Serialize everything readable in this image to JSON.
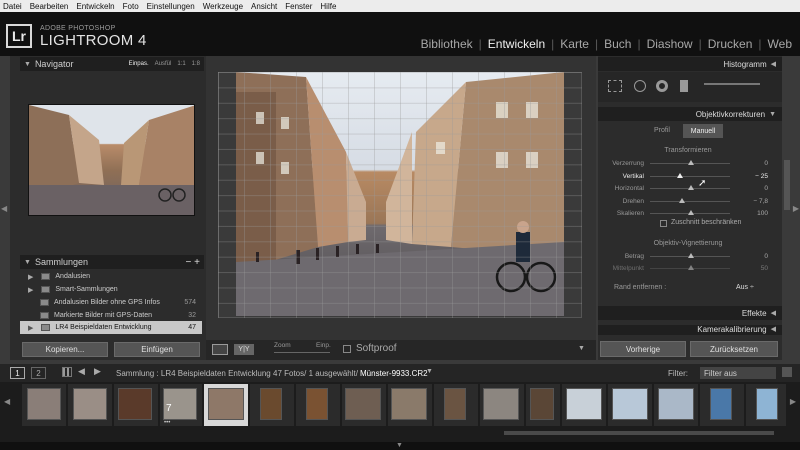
{
  "menubar": [
    "Datei",
    "Bearbeiten",
    "Entwickeln",
    "Foto",
    "Einstellungen",
    "Werkzeuge",
    "Ansicht",
    "Fenster",
    "Hilfe"
  ],
  "brand": {
    "logo": "Lr",
    "line1": "ADOBE PHOTOSHOP",
    "line2": "LIGHTROOM 4"
  },
  "modules": [
    {
      "label": "Bibliothek",
      "active": false
    },
    {
      "label": "Entwickeln",
      "active": true
    },
    {
      "label": "Karte",
      "active": false
    },
    {
      "label": "Buch",
      "active": false
    },
    {
      "label": "Diashow",
      "active": false
    },
    {
      "label": "Drucken",
      "active": false
    },
    {
      "label": "Web",
      "active": false
    }
  ],
  "navigator": {
    "title": "Navigator",
    "options": [
      "Einpas.",
      "Ausfül",
      "1:1",
      "1:8"
    ],
    "selected": "Einpas."
  },
  "collections": {
    "title": "Sammlungen",
    "items": [
      {
        "label": "Andalusien",
        "count": "",
        "selected": false
      },
      {
        "label": "Smart-Sammlungen",
        "count": "",
        "selected": false
      },
      {
        "label": "Andalusien Bilder ohne GPS Infos",
        "count": "574",
        "selected": false
      },
      {
        "label": "Markierte Bilder mit GPS-Daten",
        "count": "32",
        "selected": false
      },
      {
        "label": "LR4 Beispieldaten Entwicklung",
        "count": "47",
        "selected": true
      }
    ]
  },
  "left_buttons": {
    "copy": "Kopieren...",
    "paste": "Einfügen"
  },
  "toolbar": {
    "zoom_label": "Zoom",
    "fit_label": "Einp.",
    "softproof": "Softproof"
  },
  "right": {
    "histogram": "Histogramm",
    "lens": "Objektivkorrekturen",
    "tabs": [
      "Profil",
      "Manuell"
    ],
    "active_tab": "Manuell",
    "transform_title": "Transformieren",
    "sliders": [
      {
        "label": "Verzerrung",
        "value": "0",
        "pos": 0.5,
        "hl": false
      },
      {
        "label": "Vertikal",
        "value": "− 25",
        "pos": 0.37,
        "hl": true
      },
      {
        "label": "Horizontal",
        "value": "0",
        "pos": 0.5,
        "hl": false
      },
      {
        "label": "Drehen",
        "value": "− 7,8",
        "pos": 0.39,
        "hl": false
      },
      {
        "label": "Skalieren",
        "value": "100",
        "pos": 0.5,
        "hl": false
      }
    ],
    "crop_label": "Zuschnitt beschränken",
    "vignette_title": "Objektiv-Vignettierung",
    "vignette_sliders": [
      {
        "label": "Betrag",
        "value": "0",
        "pos": 0.5
      },
      {
        "label": "Mittelpunkt",
        "value": "50",
        "pos": 0.5
      }
    ],
    "remove_label": "Rand entfernen :",
    "remove_value": "Aus",
    "effects": "Effekte",
    "calibration": "Kamerakalibrierung",
    "prev_btn": "Vorherige",
    "reset_btn": "Zurücksetzen"
  },
  "filmstrip": {
    "page1": "1",
    "page2": "2",
    "path": "Sammlung : LR4 Beispieldaten Entwicklung",
    "count": "47 Fotos/ 1 ausgewählt/",
    "file": "Münster-9933.CR2",
    "filter_label": "Filter:",
    "filter_value": "Filter aus"
  },
  "colors": {
    "accent": "#e4e4e4",
    "panel": "#2c2c2c",
    "header": "#101010"
  }
}
